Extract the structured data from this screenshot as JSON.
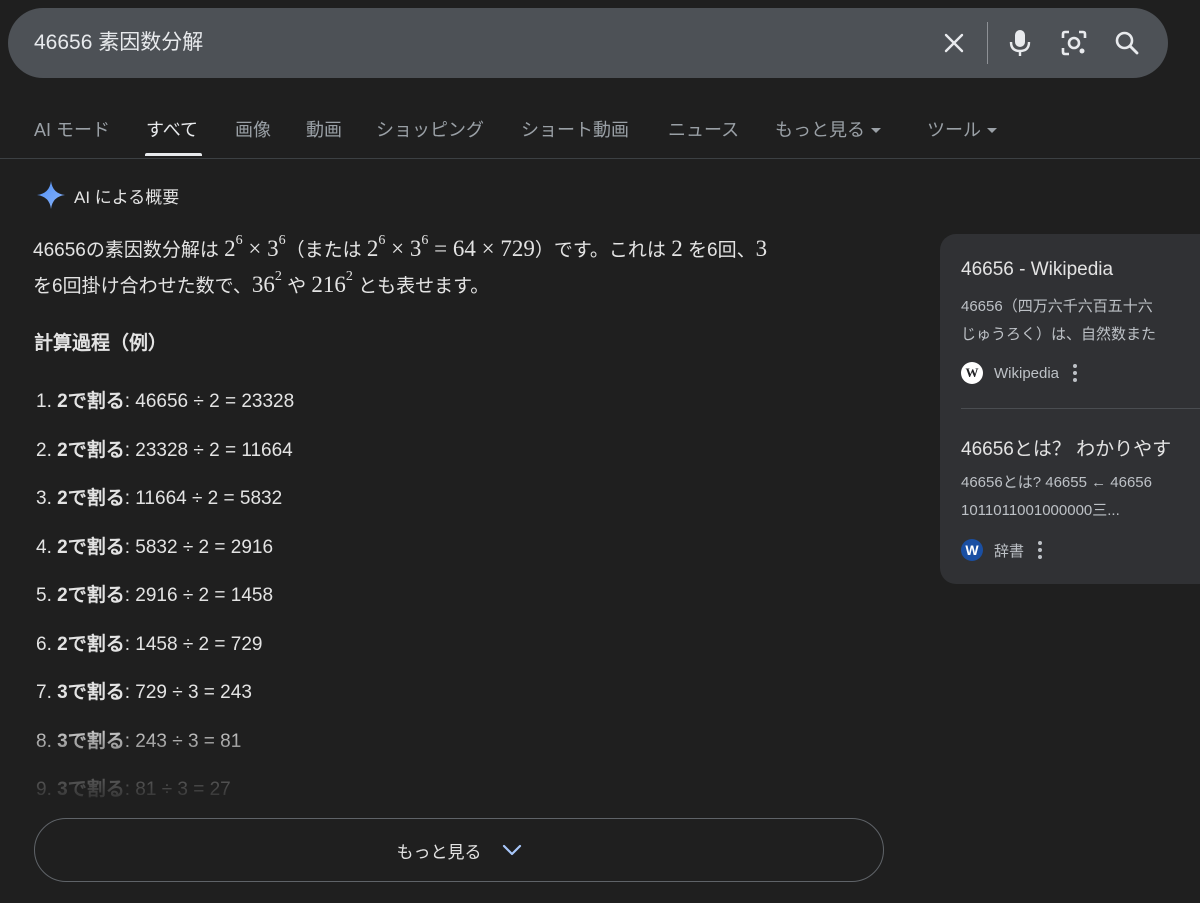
{
  "search": {
    "query": "46656 素因数分解",
    "icons": [
      "close-icon",
      "microphone-icon",
      "camera-lens-icon",
      "search-icon"
    ]
  },
  "tabs": [
    {
      "label": "AI モード",
      "active": false
    },
    {
      "label": "すべて",
      "active": true
    },
    {
      "label": "画像",
      "active": false
    },
    {
      "label": "動画",
      "active": false
    },
    {
      "label": "ショッピング",
      "active": false
    },
    {
      "label": "ショート動画",
      "active": false
    },
    {
      "label": "ニュース",
      "active": false
    },
    {
      "label": "もっと見る",
      "active": false
    },
    {
      "label": "ツール",
      "active": false
    }
  ],
  "ai_overview": {
    "title": "AI による概要",
    "summary": {
      "number": "46656",
      "t1": "の素因数分解は ",
      "t2": "（または ",
      "t3": "）です。これは ",
      "base2": "2",
      "t4": " を",
      "times1": "6",
      "t5": "回、",
      "base3": "3",
      "t6": "を",
      "times2": "6",
      "t7": "回掛け合わせた数で、",
      "t8": " や ",
      "t9": " とも表せます。",
      "math_a": "2",
      "math_a_exp": "6",
      "math_times": "×",
      "math_b": "3",
      "math_b_exp": "6",
      "math_eq": "= 64 × 729",
      "math_c": "36",
      "math_c_exp": "2",
      "math_d": "216",
      "math_d_exp": "2"
    },
    "section_title": "計算過程（例）",
    "steps": [
      {
        "num": "1.",
        "bold": "2で割る",
        "rest": ": 46656 ÷ 2 = 23328"
      },
      {
        "num": "2.",
        "bold": "2で割る",
        "rest": ": 23328 ÷ 2 = 11664"
      },
      {
        "num": "3.",
        "bold": "2で割る",
        "rest": ": 11664 ÷ 2 = 5832"
      },
      {
        "num": "4.",
        "bold": "2で割る",
        "rest": ": 5832 ÷ 2 = 2916"
      },
      {
        "num": "5.",
        "bold": "2で割る",
        "rest": ": 2916 ÷ 2 = 1458"
      },
      {
        "num": "6.",
        "bold": "2で割る",
        "rest": ": 1458 ÷ 2 = 729"
      },
      {
        "num": "7.",
        "bold": "3で割る",
        "rest": ": 729 ÷ 3 = 243"
      },
      {
        "num": "8.",
        "bold": "3で割る",
        "rest": ": 243 ÷ 3 = 81"
      },
      {
        "num": "9.",
        "bold": "3で割る",
        "rest": ": 81 ÷ 3 = 27"
      }
    ],
    "more_label": "もっと見る"
  },
  "sources": [
    {
      "title": "46656 - Wikipedia",
      "snippet_line1": "46656（四万六千六百五十六",
      "snippet_line2": "じゅうろく）は、自然数また",
      "source_name": "Wikipedia",
      "favicon_letter": "W"
    },
    {
      "title": "46656とは？ わかりやす",
      "snippet_line1": "46656とは? 46655 ← 46656",
      "snippet_line2": "1011011001000000三...",
      "source_name": "辞書",
      "favicon_letter": "W"
    }
  ],
  "colors": {
    "background": "#1f1f1f",
    "searchbar": "#4d5156",
    "card": "#303134",
    "ai_sparkle": "#4285f4"
  }
}
